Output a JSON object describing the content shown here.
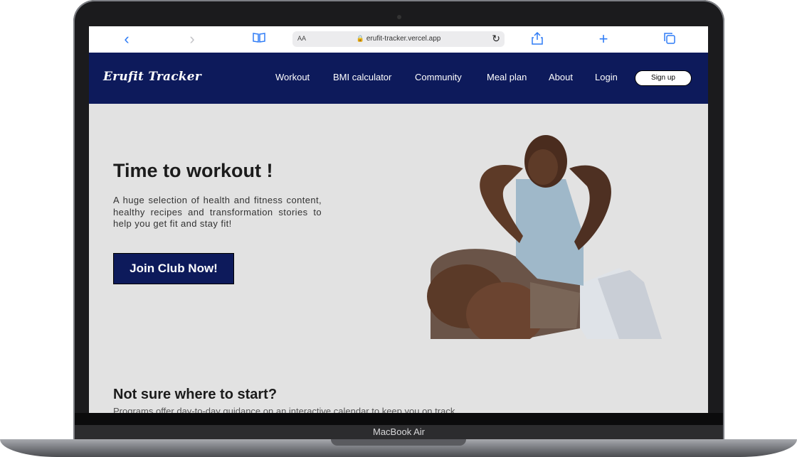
{
  "device": {
    "label": "MacBook Air"
  },
  "browser": {
    "text_size_label": "AA",
    "url": "erufit-tracker.vercel.app",
    "icons": [
      "back-icon",
      "forward-icon",
      "bookmarks-icon",
      "lock-icon",
      "reload-icon",
      "share-icon",
      "new-tab-icon",
      "tabs-icon"
    ]
  },
  "site": {
    "brand": "Erufit Tracker",
    "nav": [
      "Workout",
      "BMI calculator",
      "Community",
      "Meal plan",
      "About",
      "Login"
    ],
    "signup": "Sign up",
    "colors": {
      "nav_bg": "#0d1a5b",
      "page_bg": "#e2e2e2",
      "button_bg": "#0d1a5b"
    }
  },
  "hero": {
    "title": "Time to workout !",
    "text": "A huge selection of health and fitness content, healthy recipes and transformation stories to help you get fit and stay fit!",
    "cta": "Join Club Now!"
  },
  "section": {
    "title": "Not sure where to start?",
    "subtitle": "Programs offer day-to-day guidance on an interactive calendar to keep you on track."
  }
}
